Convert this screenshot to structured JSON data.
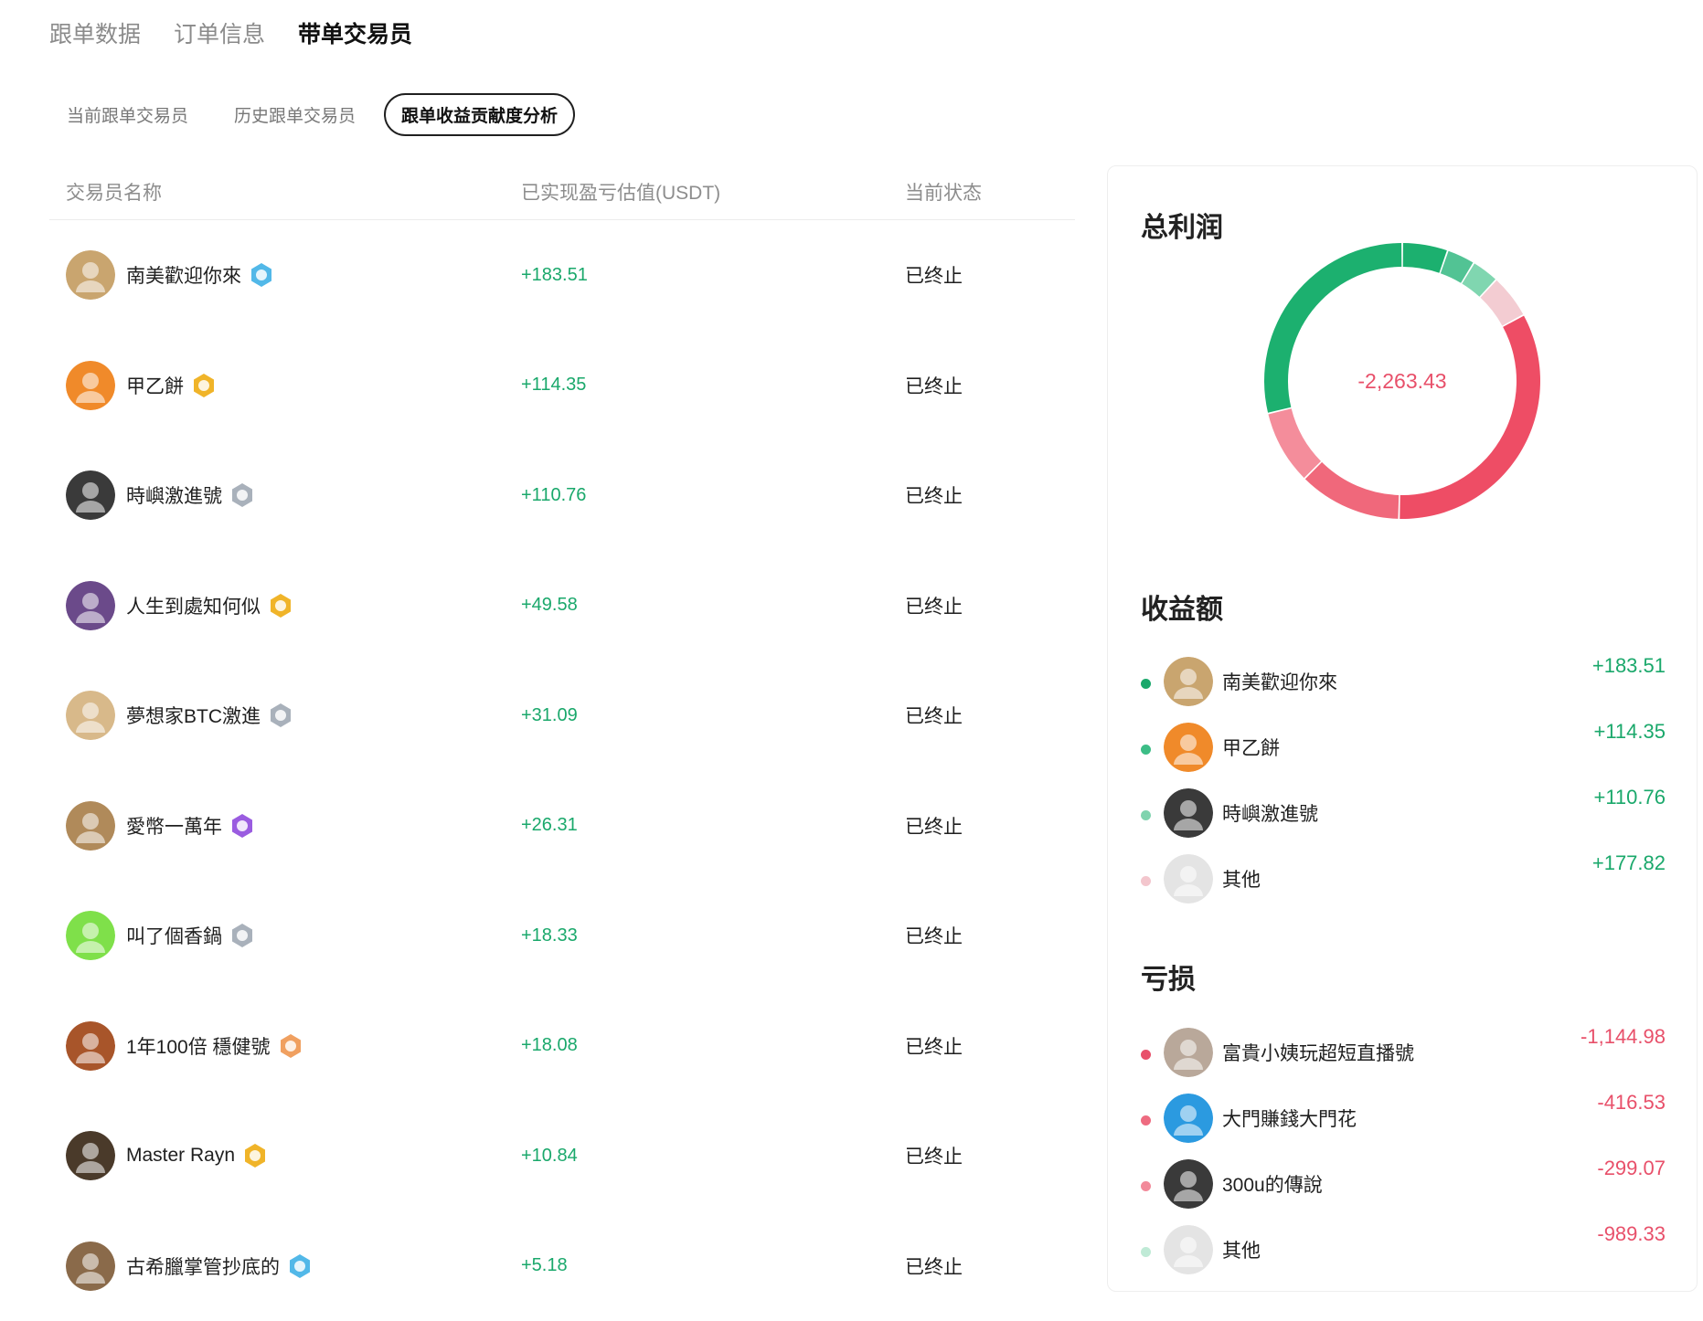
{
  "top_tabs": [
    "跟单数据",
    "订单信息",
    "带单交易员"
  ],
  "sub_tabs": [
    "当前跟单交易员",
    "历史跟单交易员",
    "跟单收益贡献度分析"
  ],
  "table": {
    "headers": [
      "交易员名称",
      "已实现盈亏估值(USDT)",
      "当前状态"
    ],
    "rows": [
      {
        "name": "南美歡迎你來",
        "pnl": "+183.51",
        "status": "已终止",
        "avatar": "#c9a56f",
        "badge": "#52b8e8"
      },
      {
        "name": "甲乙餅",
        "pnl": "+114.35",
        "status": "已终止",
        "avatar": "#f08a2a",
        "badge": "#f0b429"
      },
      {
        "name": "時嶼激進號",
        "pnl": "+110.76",
        "status": "已终止",
        "avatar": "#3a3a3a",
        "badge": "#a9b1bb"
      },
      {
        "name": "人生到處知何似",
        "pnl": "+49.58",
        "status": "已终止",
        "avatar": "#6b4a8a",
        "badge": "#f0b429"
      },
      {
        "name": "夢想家BTC激進",
        "pnl": "+31.09",
        "status": "已终止",
        "avatar": "#d8b98a",
        "badge": "#a9b1bb"
      },
      {
        "name": "愛幣一萬年",
        "pnl": "+26.31",
        "status": "已终止",
        "avatar": "#b08a5a",
        "badge": "#9a5ce0"
      },
      {
        "name": "叫了個香鍋",
        "pnl": "+18.33",
        "status": "已终止",
        "avatar": "#7fe04a",
        "badge": "#a9b1bb"
      },
      {
        "name": "1年100倍 穩健號",
        "pnl": "+18.08",
        "status": "已终止",
        "avatar": "#a8552a",
        "badge": "#f0a060"
      },
      {
        "name": "Master Rayn",
        "pnl": "+10.84",
        "status": "已终止",
        "avatar": "#4a3a2a",
        "badge": "#f0b429"
      },
      {
        "name": "古希臘掌管抄底的",
        "pnl": "+5.18",
        "status": "已终止",
        "avatar": "#8a6a4a",
        "badge": "#52b8e8"
      }
    ]
  },
  "panel": {
    "total_title": "总利润",
    "total_value": "-2,263.43",
    "gain_title": "收益额",
    "loss_title": "亏损",
    "gains": [
      {
        "name": "南美歡迎你來",
        "value": "+183.51",
        "dot": "#1aa86b",
        "avatar": "#c9a56f"
      },
      {
        "name": "甲乙餅",
        "value": "+114.35",
        "dot": "#3cbd86",
        "avatar": "#f08a2a"
      },
      {
        "name": "時嶼激進號",
        "value": "+110.76",
        "dot": "#7fd3ae",
        "avatar": "#3a3a3a"
      },
      {
        "name": "其他",
        "value": "+177.82",
        "dot": "#f3c6cd",
        "avatar": "#e4e4e4"
      }
    ],
    "losses": [
      {
        "name": "富貴小姨玩超短直播號",
        "value": "-1,144.98",
        "dot": "#e8506a",
        "avatar": "#b9a89a"
      },
      {
        "name": "大門賺錢大門花",
        "value": "-416.53",
        "dot": "#ee6b80",
        "avatar": "#2b9ae0"
      },
      {
        "name": "300u的傳說",
        "value": "-299.07",
        "dot": "#f28a9a",
        "avatar": "#3a3a3a"
      },
      {
        "name": "其他",
        "value": "-989.33",
        "dot": "#bfead6",
        "avatar": "#e4e4e4"
      }
    ]
  },
  "chart_data": {
    "type": "pie",
    "variant": "donut",
    "center_label": "-2,263.43",
    "slices": [
      {
        "label": "南美歡迎你來",
        "value": 183.51,
        "color": "#1cb06f"
      },
      {
        "label": "甲乙餅",
        "value": 114.35,
        "color": "#52c394"
      },
      {
        "label": "時嶼激進號",
        "value": 110.76,
        "color": "#80d6b0"
      },
      {
        "label": "其他",
        "value": 177.82,
        "color": "#f3ccd2"
      },
      {
        "label": "富貴小姨玩超短直播號",
        "value": 1144.98,
        "color": "#ee4d65"
      },
      {
        "label": "大門賺錢大門花",
        "value": 416.53,
        "color": "#f0687b"
      },
      {
        "label": "300u的傳說",
        "value": 299.07,
        "color": "#f48d9b"
      },
      {
        "label": "其他",
        "value": 989.33,
        "color": "#1cb06f"
      }
    ]
  }
}
